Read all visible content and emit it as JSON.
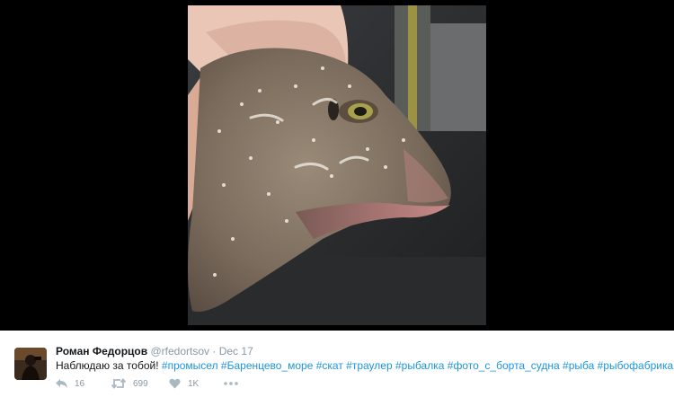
{
  "tweet": {
    "author_name": "Роман Федорцов",
    "handle": "@rfedortsov",
    "separator": "·",
    "date": "Dec 17",
    "text_plain": "Наблюдаю за тобой!",
    "hashtags": [
      "#промысел",
      "#Баренцево_море",
      "#скат",
      "#траулер",
      "#рыбалка",
      "#фото_с_борта_судна",
      "#рыба",
      "#рыбофабрика"
    ],
    "actions": {
      "reply_count": "16",
      "retweet_count": "699",
      "like_count": "1K"
    }
  },
  "icons": {
    "reply": "reply-icon",
    "retweet": "retweet-icon",
    "like": "heart-icon",
    "more": "more-icon"
  },
  "colors": {
    "link": "#1b95e0",
    "muted": "#8899a6",
    "text": "#14171a",
    "backdrop": "#000000"
  }
}
